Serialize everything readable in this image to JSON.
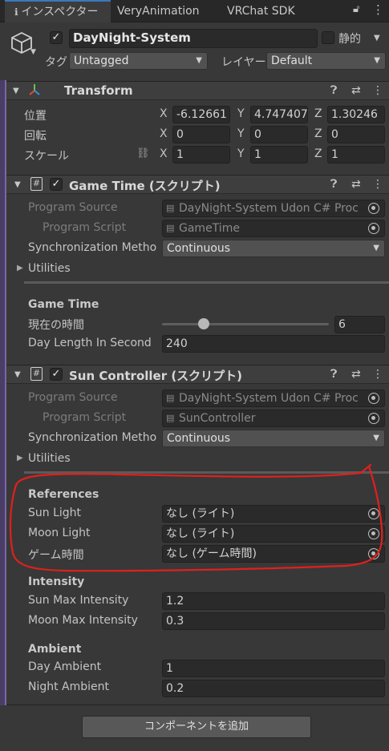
{
  "tabs": [
    {
      "label": "インスペクター",
      "active": true
    },
    {
      "label": "VeryAnimation"
    },
    {
      "label": "VRChat SDK"
    }
  ],
  "gameobject": {
    "name": "DayNight-System",
    "static_label": "静的",
    "tag_label": "タグ",
    "tag_value": "Untagged",
    "layer_label": "レイヤー",
    "layer_value": "Default"
  },
  "transform": {
    "title": "Transform",
    "position_label": "位置",
    "rotation_label": "回転",
    "scale_label": "スケール",
    "position": {
      "x": "-6.12661",
      "y": "4.747407",
      "z": "1.30246"
    },
    "rotation": {
      "x": "0",
      "y": "0",
      "z": "0"
    },
    "scale": {
      "x": "1",
      "y": "1",
      "z": "1"
    }
  },
  "gametime": {
    "title": "Game Time (スクリプト)",
    "program_source_label": "Program Source",
    "program_source_value": "DayNight-System Udon C# Proc",
    "program_script_label": "Program Script",
    "program_script_value": "GameTime",
    "sync_label": "Synchronization Metho",
    "sync_value": "Continuous",
    "utilities_label": "Utilities",
    "section_header": "Game Time",
    "current_time_label": "現在の時間",
    "current_time_value": "6",
    "current_time_fraction": 0.25,
    "day_length_label": "Day Length In Second",
    "day_length_value": "240"
  },
  "sun": {
    "title": "Sun Controller (スクリプト)",
    "program_source_label": "Program Source",
    "program_source_value": "DayNight-System Udon C# Proc",
    "program_script_label": "Program Script",
    "program_script_value": "SunController",
    "sync_label": "Synchronization Metho",
    "sync_value": "Continuous",
    "utilities_label": "Utilities",
    "references_header": "References",
    "sun_light_label": "Sun Light",
    "sun_light_value": "なし (ライト)",
    "moon_light_label": "Moon Light",
    "moon_light_value": "なし (ライト)",
    "gametime_label": "ゲーム時間",
    "gametime_value": "なし (ゲーム時間)",
    "intensity_header": "Intensity",
    "sun_max_label": "Sun Max Intensity",
    "sun_max_value": "1.2",
    "moon_max_label": "Moon Max Intensity",
    "moon_max_value": "0.3",
    "ambient_header": "Ambient",
    "day_ambient_label": "Day Ambient",
    "day_ambient_value": "1",
    "night_ambient_label": "Night Ambient",
    "night_ambient_value": "0.2"
  },
  "add_component_label": "コンポーネントを追加",
  "colors": {
    "accent": "#3a79bb",
    "annotation": "#e0201c",
    "background": "#383838"
  }
}
